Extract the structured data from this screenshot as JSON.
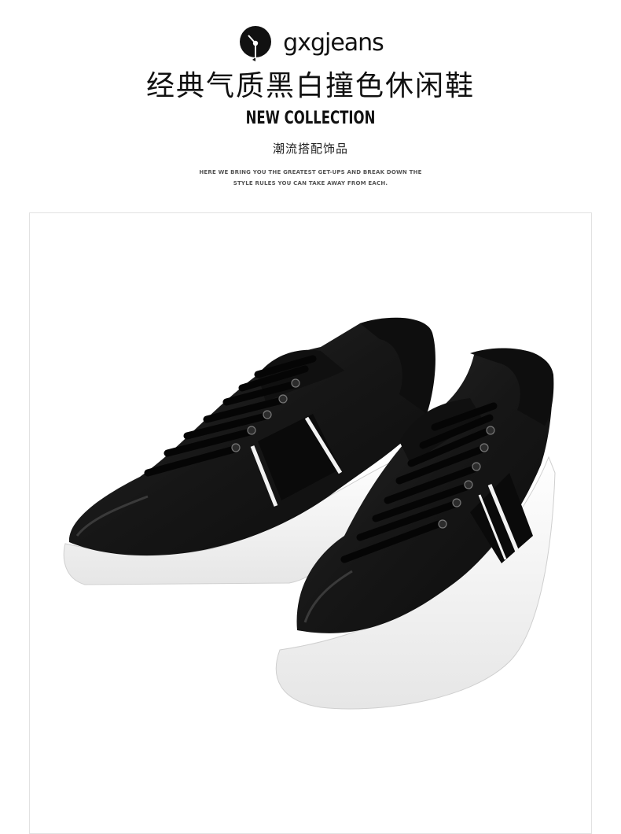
{
  "brand": {
    "name": "gxgjeans",
    "logo_icon": "gxg-circle-logo-icon"
  },
  "header": {
    "title": "经典气质黑白撞色休闲鞋",
    "subtitle_en": "NEW COLLECTION",
    "subtitle_cn": "潮流搭配饰品",
    "tagline_line1": "HERE WE BRING YOU THE GREATEST GET-UPS AND BREAK DOWN THE",
    "tagline_line2": "STYLE RULES YOU CAN TAKE AWAY FROM EACH."
  },
  "product": {
    "image_subject": "black-white-sneakers"
  },
  "colors": {
    "text": "#111111",
    "frame_border": "#e2e2e2",
    "shoe_black": "#1a1a1a",
    "sole_white": "#f7f7f7"
  }
}
